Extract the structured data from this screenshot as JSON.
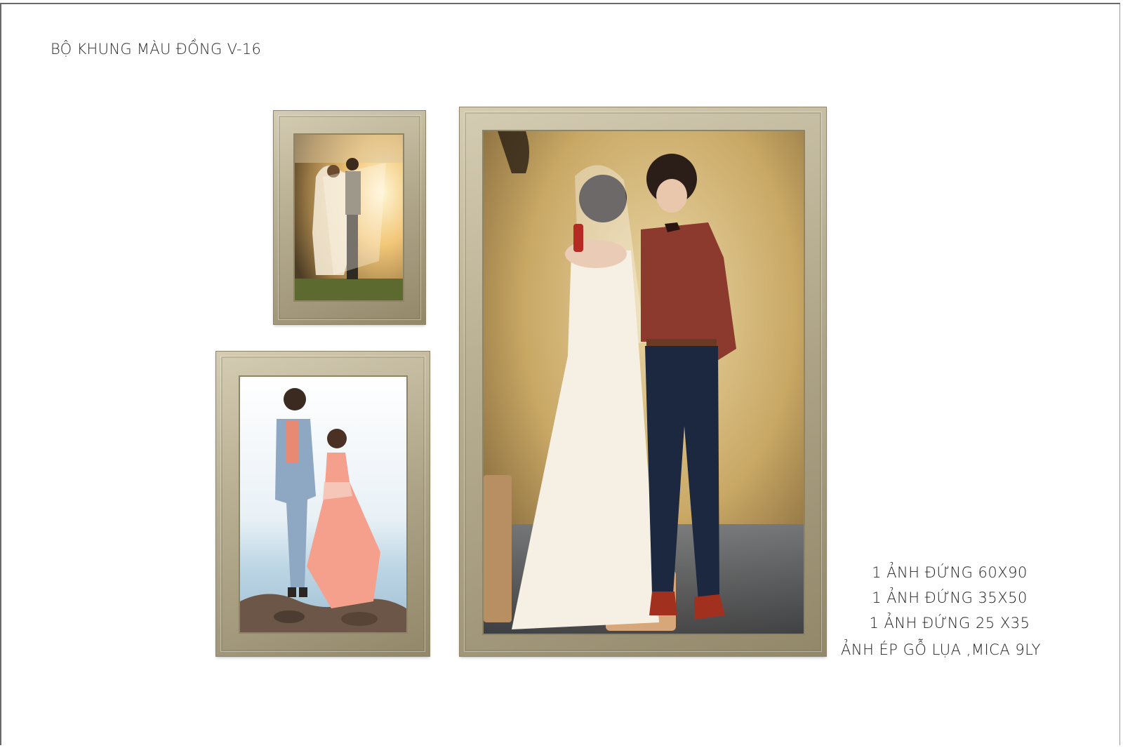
{
  "header": {
    "title": "BỘ KHUNG MÀU ĐỒNG V-16"
  },
  "frames": [
    {
      "photo": "couple-backlit-veil"
    },
    {
      "photo": "couple-beach"
    },
    {
      "photo": "couple-bride-groom-vintage"
    }
  ],
  "specs": {
    "lines": [
      "1 ẢNH ĐỨNG 60X90",
      "1 ẢNH ĐỨNG 35X50",
      "1 ẢNH ĐỨNG 25 X35"
    ],
    "note": "ẢNH ÉP GỖ LỤA ,MICA 9LY"
  },
  "colors": {
    "frame_gold": "#b7ab89",
    "text": "#222222"
  }
}
